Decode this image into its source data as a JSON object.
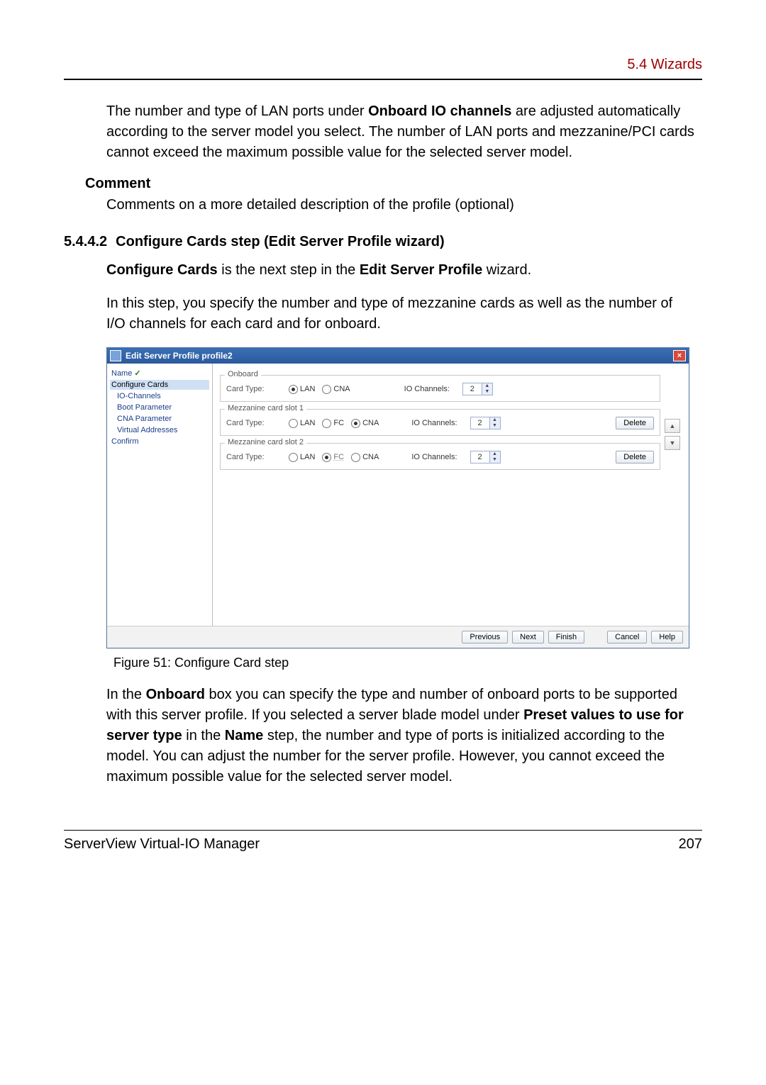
{
  "header": {
    "section": "5.4 Wizards"
  },
  "para1_parts": {
    "p1_a": "The number and type of LAN ports under ",
    "p1_b": "Onboard IO channels",
    "p1_c": " are adjusted automatically according to the server model you select. The number of LAN ports and mezzanine/PCI cards cannot exceed the maximum possible value for the selected server model."
  },
  "comment": {
    "term": "Comment",
    "desc": "Comments on a more detailed description of the profile (optional)"
  },
  "subheading": {
    "num": "5.4.4.2",
    "title": "Configure Cards step (Edit Server Profile wizard)"
  },
  "para2_parts": {
    "a": "Configure Cards",
    "b": " is the next step in the ",
    "c": "Edit Server Profile",
    "d": " wizard."
  },
  "para3": "In this step, you specify the number and type of mezzanine cards as well as the number of I/O channels for each card and for onboard.",
  "wizard": {
    "title": "Edit Server Profile profile2",
    "nav": {
      "name": "Name",
      "configure_cards": "Configure Cards",
      "io_channels": "IO-Channels",
      "boot_parameter": "Boot Parameter",
      "cna_parameter": "CNA Parameter",
      "virtual_addresses": "Virtual Addresses",
      "confirm": "Confirm"
    },
    "labels": {
      "card_type": "Card Type:",
      "io_channels": "IO Channels:",
      "onboard": "Onboard",
      "mezz1": "Mezzanine card slot 1",
      "mezz2": "Mezzanine card slot 2"
    },
    "radios": {
      "lan": "LAN",
      "fc": "FC",
      "cna": "CNA"
    },
    "values": {
      "onboard_io": "2",
      "mezz1_io": "2",
      "mezz2_io": "2"
    },
    "buttons": {
      "delete": "Delete",
      "previous": "Previous",
      "next": "Next",
      "finish": "Finish",
      "cancel": "Cancel",
      "help": "Help"
    }
  },
  "figure_caption": "Figure 51: Configure Card step",
  "para4_parts": {
    "a": "In the ",
    "b": "Onboard",
    "c": " box you can specify the type and number of onboard ports to be supported with this server profile. If you selected a server blade model under ",
    "d": "Preset values to use for server type",
    "e": " in the ",
    "f": "Name",
    "g": " step, the number and type of ports is initialized according to the model. You can adjust the number for the server profile. However, you cannot exceed the maximum possible value for the selected server model."
  },
  "footer": {
    "product": "ServerView Virtual-IO Manager",
    "page": "207"
  }
}
